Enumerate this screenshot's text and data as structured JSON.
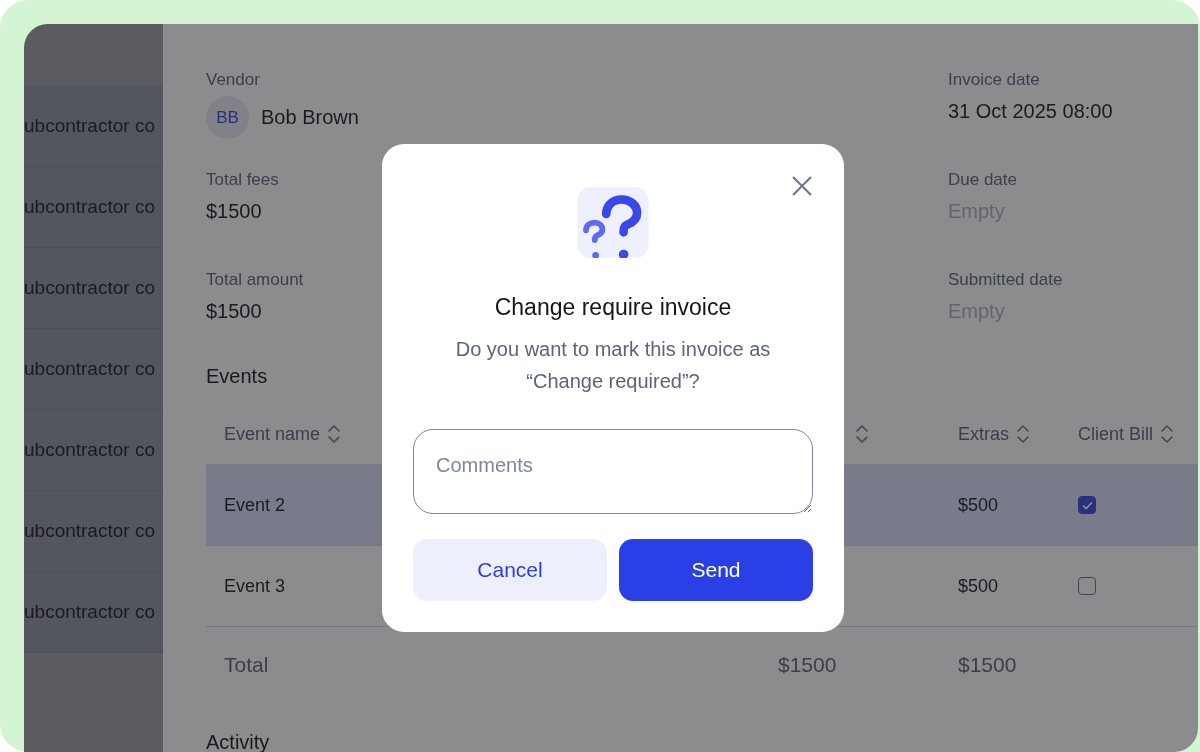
{
  "sidebar": {
    "rows": [
      "ubcontractor co",
      "ubcontractor co",
      "ubcontractor co",
      "ubcontractor co",
      "ubcontractor co",
      "ubcontractor co",
      "ubcontractor co"
    ]
  },
  "details": [
    {
      "label": "Vendor",
      "value": "Bob Brown",
      "avatar": "BB",
      "empty": false
    },
    {
      "label": "Invoice date",
      "value": "31 Oct 2025 08:00",
      "empty": false
    },
    {
      "label": "Total fees",
      "value": "$1500",
      "empty": false
    },
    {
      "label": "Due date",
      "value": "Empty",
      "empty": true
    },
    {
      "label": "Total amount",
      "value": "$1500",
      "empty": false
    },
    {
      "label": "Submitted date",
      "value": "Empty",
      "empty": true
    }
  ],
  "events": {
    "title": "Events",
    "columns": [
      {
        "label": "Event name",
        "sortable": true
      },
      {
        "sortable": true
      },
      {
        "label": "Extras",
        "sortable": true
      },
      {
        "label": "Client Bill",
        "sortable": true
      }
    ],
    "rows": [
      {
        "name": "Event 2",
        "extras": "$500",
        "client_bill": true,
        "selected": true
      },
      {
        "name": "Event 3",
        "extras": "$500",
        "client_bill": false,
        "selected": false
      }
    ],
    "total": {
      "label": "Total",
      "values": [
        "$1500",
        "$1500"
      ]
    }
  },
  "activity": {
    "title": "Activity"
  },
  "dialog": {
    "title": "Change require invoice",
    "message": "Do you want to mark this invoice as “Change required”?",
    "comments": {
      "placeholder": "Comments"
    },
    "buttons": [
      {
        "label": "Cancel",
        "kind": "secondary"
      },
      {
        "label": "Send",
        "kind": "primary"
      }
    ]
  }
}
